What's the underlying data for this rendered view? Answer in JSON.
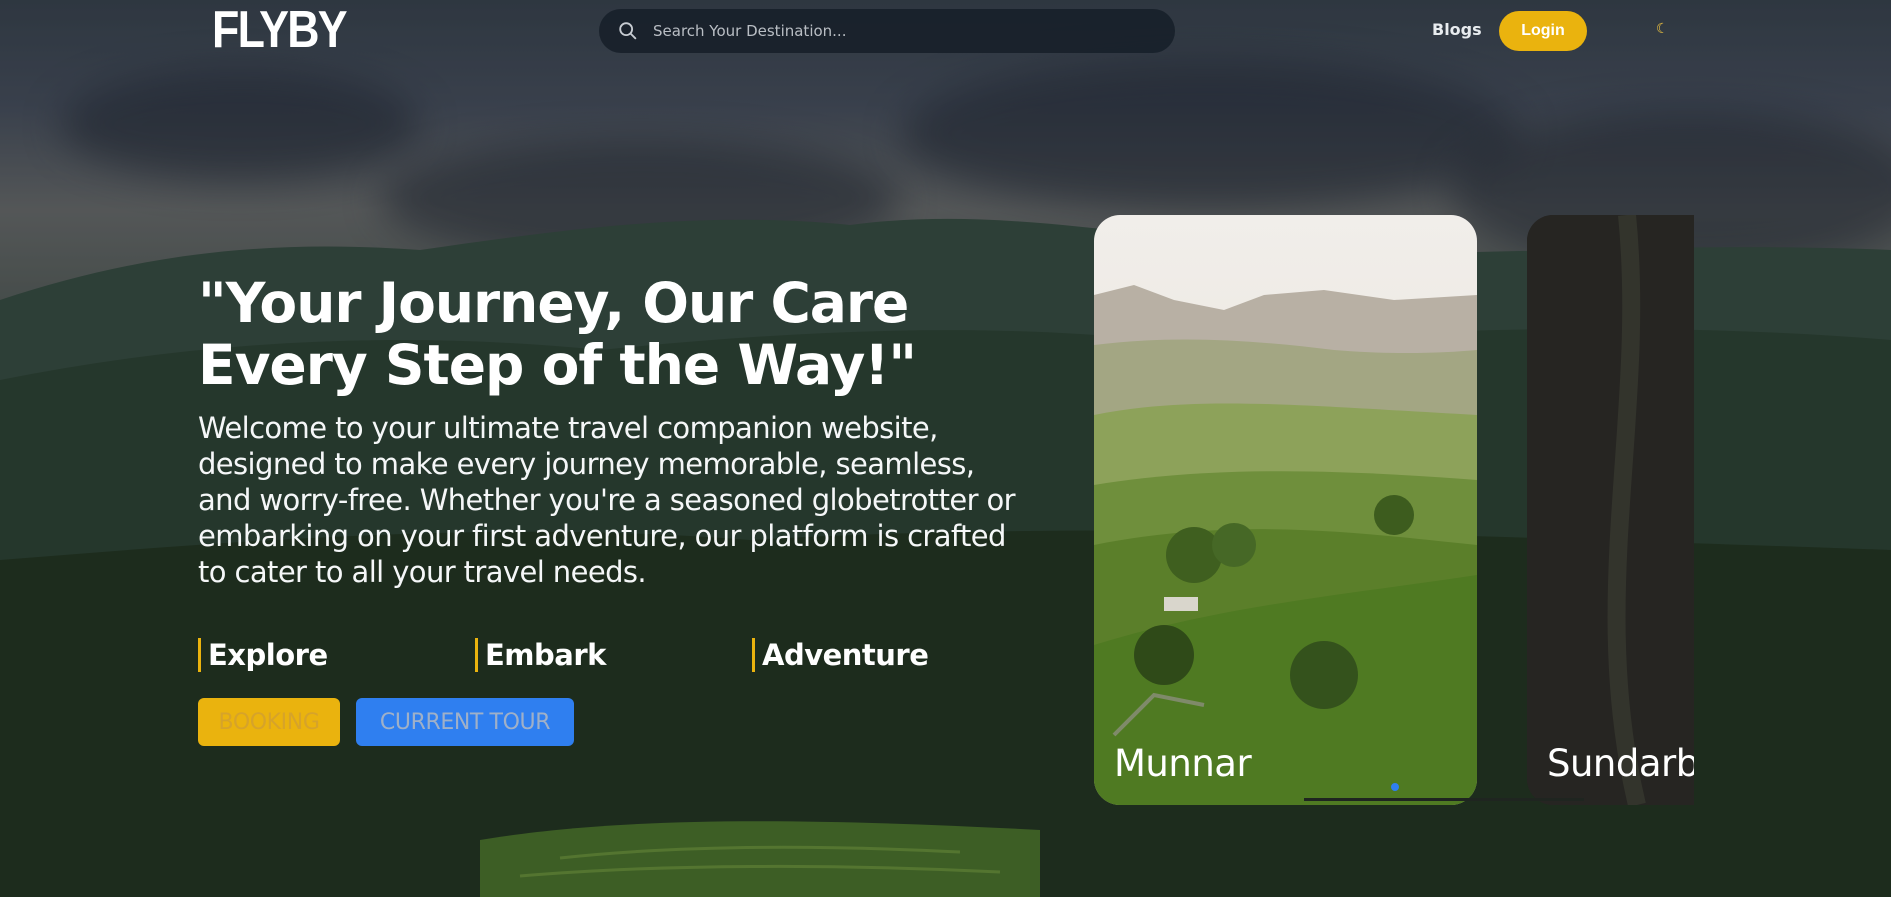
{
  "header": {
    "logo": "FLYBY",
    "search": {
      "placeholder": "Search Your Destination...",
      "icon": "search-icon"
    },
    "nav": {
      "blogs_label": "Blogs",
      "login_label": "Login"
    },
    "theme_toggle_icon": "moon-icon"
  },
  "hero": {
    "headline": "\"Your Journey, Our Care Every Step of the Way!\"",
    "description": "Welcome to your ultimate travel companion website, designed to make every journey memorable, seamless, and worry-free. Whether you're a seasoned globetrotter or embarking on your first adventure, our platform is crafted to cater to all your travel needs.",
    "pillars": [
      "Explore",
      "Embark",
      "Adventure"
    ],
    "buttons": {
      "booking": "BOOKING",
      "current_tour": "CURRENT TOUR"
    }
  },
  "carousel": {
    "cards": [
      {
        "label": "Munnar"
      },
      {
        "label": "Sundarba"
      }
    ]
  },
  "colors": {
    "accent": "#eab30e",
    "primary_blue": "#2f7ff0",
    "search_bg": "#18212a"
  }
}
